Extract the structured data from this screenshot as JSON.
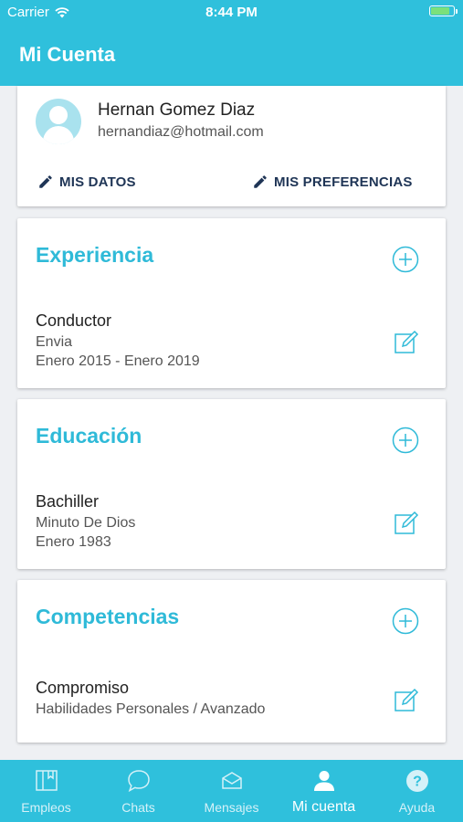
{
  "status_bar": {
    "carrier": "Carrier",
    "time": "8:44 PM",
    "battery_level": 0.85
  },
  "header": {
    "title": "Mi Cuenta"
  },
  "profile": {
    "name": "Hernan Gomez Diaz",
    "email": "hernandiaz@hotmail.com",
    "mis_datos_label": "MIS DATOS",
    "mis_preferencias_label": "MIS PREFERENCIAS"
  },
  "sections": {
    "experiencia": {
      "title": "Experiencia",
      "item": {
        "title": "Conductor",
        "line1": "Envia",
        "line2": "Enero 2015 - Enero 2019"
      }
    },
    "educacion": {
      "title": "Educación",
      "item": {
        "title": "Bachiller",
        "line1": "Minuto De Dios",
        "line2": "Enero 1983"
      }
    },
    "competencias": {
      "title": "Competencias",
      "item": {
        "title": "Compromiso",
        "line1": "Habilidades Personales / Avanzado"
      }
    }
  },
  "tabs": [
    {
      "label": "Empleos",
      "icon": "book-icon"
    },
    {
      "label": "Chats",
      "icon": "chat-icon"
    },
    {
      "label": "Mensajes",
      "icon": "mail-icon"
    },
    {
      "label": "Mi cuenta",
      "icon": "person-icon",
      "active": true
    },
    {
      "label": "Ayuda",
      "icon": "help-icon"
    }
  ],
  "colors": {
    "accent": "#2fc0dc",
    "title_accent": "#2fbad8",
    "link": "#1f3556",
    "background": "#eef0f3"
  }
}
